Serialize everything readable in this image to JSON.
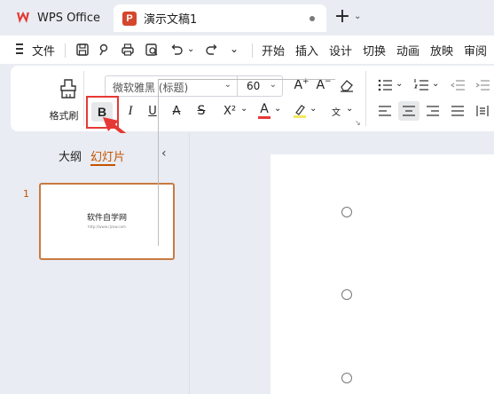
{
  "tabs": {
    "home_label": "WPS Office",
    "doc_badge": "P",
    "doc_title": "演示文稿1"
  },
  "menu": {
    "file_label": "文件",
    "items": [
      "开始",
      "插入",
      "设计",
      "切换",
      "动画",
      "放映",
      "审阅"
    ]
  },
  "ribbon": {
    "format_painter_label": "格式刷",
    "font_name": "微软雅黑 (标题)",
    "font_size": "60",
    "bold_label": "B",
    "italic_label": "I",
    "underline_label": "U",
    "strike_label": "A",
    "strike2_label": "S",
    "superscript_label": "X²",
    "font_color_label": "A",
    "highlight_label": "⁄",
    "phonetic_label": "wén",
    "grow_label": "A",
    "shrink_label": "A",
    "font_color_hex": "#e53935",
    "highlight_color_hex": "#f5e663"
  },
  "left_panel": {
    "outline_tab": "大纲",
    "slides_tab": "幻灯片",
    "slide_number": "1",
    "thumb_title": "软件自学网",
    "thumb_subtitle": "http://www.rjzxw.com"
  },
  "colors": {
    "accent": "#c45300",
    "highlight_red": "#e53935",
    "ppt_badge": "#d4472d"
  }
}
